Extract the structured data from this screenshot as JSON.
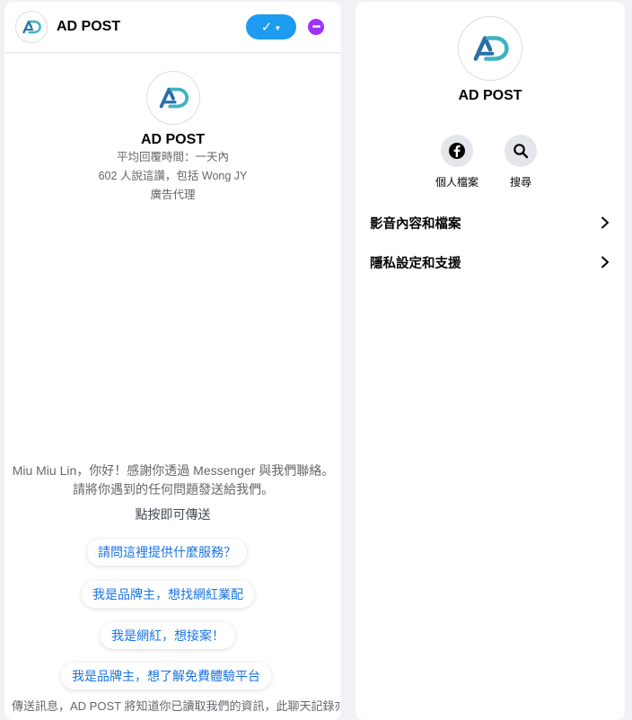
{
  "chat": {
    "header": {
      "title": "AD POST",
      "action_label": "✓",
      "more_label": "•••"
    },
    "profile": {
      "name": "AD POST",
      "response_time": "平均回覆時間：一天內",
      "likes": "602 人說這讚，包括 Wong JY",
      "category": "廣告代理"
    },
    "welcome_message": "Miu Miu Lin，你好！感謝你透過 Messenger 與我們聯絡。請將你遇到的任何問題發送給我們。",
    "tap_hint": "點按即可傳送",
    "quick_replies": [
      "請問這裡提供什麼服務？",
      "我是品牌主，想找網紅業配",
      "我是網紅，想接案！",
      "我是品牌主，想了解免費體驗平台"
    ],
    "cut_off_text": "傳送訊息，AD POST 將知道你已讀取我們的資訊，此聊天記錄亦可能會保存以提供更好的服務及回覆。"
  },
  "info": {
    "name": "AD POST",
    "actions": [
      {
        "label": "個人檔案",
        "icon": "facebook-icon"
      },
      {
        "label": "搜尋",
        "icon": "search-icon"
      }
    ],
    "menu": [
      {
        "label": "影音內容和檔案"
      },
      {
        "label": "隱私設定和支援"
      }
    ]
  },
  "colors": {
    "accent": "#1d9bf0",
    "more_button": "#a033ff",
    "quick_reply_text": "#1b74e4",
    "logo_teal": "#3fb3c3",
    "logo_blue": "#2a6fa8"
  }
}
